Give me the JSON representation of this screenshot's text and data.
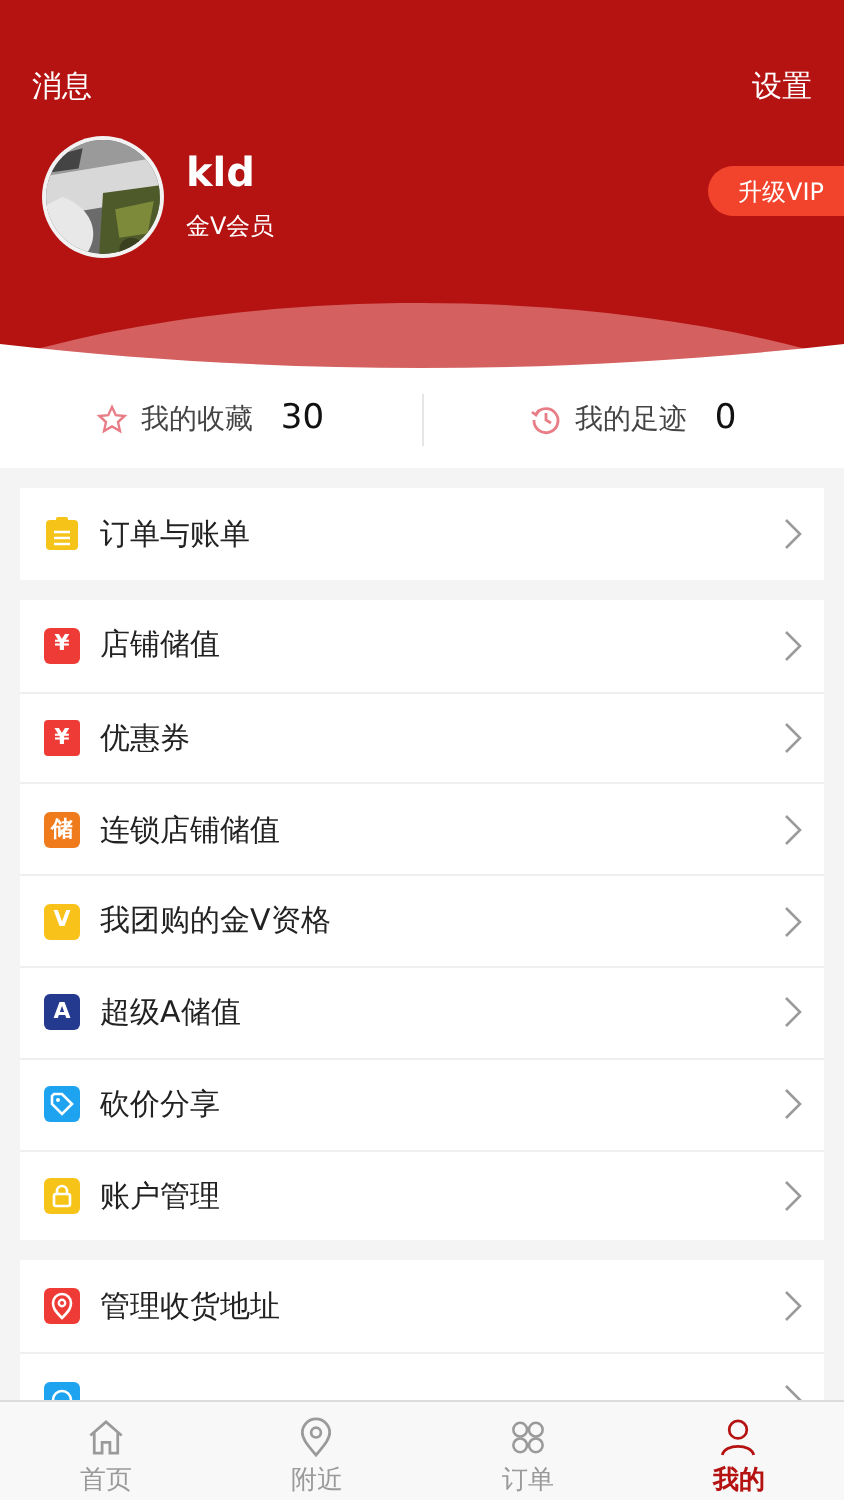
{
  "header": {
    "left": "消息",
    "right": "设置"
  },
  "profile": {
    "name": "kld",
    "level": "金V会员",
    "upgrade": "升级VIP"
  },
  "stats": [
    {
      "kind": "star",
      "label": "我的收藏",
      "count": "30"
    },
    {
      "kind": "clock",
      "label": "我的足迹",
      "count": "0"
    }
  ],
  "groups": [
    [
      {
        "kind": "clipboard",
        "color": "#f6c419",
        "label": "订单与账单"
      }
    ],
    [
      {
        "kind": "yen",
        "color": "#ef3b36",
        "label": "店铺储值",
        "glyph": "¥"
      },
      {
        "kind": "coupon",
        "color": "#ef3b36",
        "label": "优惠券",
        "glyph": "¥"
      },
      {
        "kind": "glyph",
        "color": "#f07b1c",
        "label": "连锁店铺储值",
        "glyph": "储"
      },
      {
        "kind": "glyph",
        "color": "#f8c21a",
        "label": "我团购的金V资格",
        "glyph": "V"
      },
      {
        "kind": "glyph",
        "color": "#243a8f",
        "label": "超级A储值",
        "glyph": "A"
      },
      {
        "kind": "tag",
        "color": "#1ea3f0",
        "label": "砍价分享"
      },
      {
        "kind": "lock",
        "color": "#f6c419",
        "label": "账户管理"
      }
    ],
    [
      {
        "kind": "pin",
        "color": "#ef3b36",
        "label": "管理收货地址"
      },
      {
        "kind": "service",
        "color": "#1ea3f0"
      }
    ]
  ],
  "tabs": [
    {
      "kind": "home",
      "label": "首页",
      "selected": false
    },
    {
      "kind": "pin",
      "label": "附近",
      "selected": false
    },
    {
      "kind": "clover",
      "label": "订单",
      "selected": false
    },
    {
      "kind": "person",
      "label": "我的",
      "selected": true
    }
  ]
}
